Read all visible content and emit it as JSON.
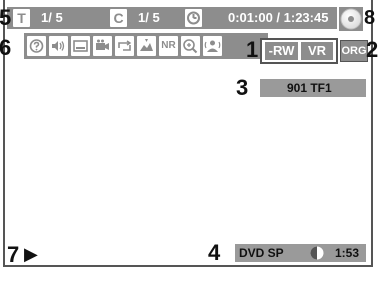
{
  "callouts": {
    "c1": "1",
    "c2": "2",
    "c3": "3",
    "c4": "4",
    "c5": "5",
    "c6": "6",
    "c7": "7",
    "c8": "8"
  },
  "status_bar": {
    "title_icon": "T",
    "title_counter": "1/  5",
    "chapter_icon": "C",
    "chapter_counter": "1/  5",
    "clock_icon": "clock-icon",
    "time": "0:01:00 / 1:23:45",
    "disc_icon": "disc-icon"
  },
  "function_icons": [
    {
      "name": "help-icon"
    },
    {
      "name": "audio-icon"
    },
    {
      "name": "subtitle-icon"
    },
    {
      "name": "camera-angle-icon"
    },
    {
      "name": "repeat-icon"
    },
    {
      "name": "marker-icon"
    },
    {
      "name": "noise-reduction-icon",
      "text": "NR"
    },
    {
      "name": "zoom-icon"
    },
    {
      "name": "virtual-surround-icon"
    }
  ],
  "format": {
    "disc_type": "-RW",
    "mode": "VR",
    "org": "ORG"
  },
  "channel": "901  TF1",
  "record": {
    "mode": "DVD SP",
    "time_left": "1:53"
  },
  "playback_arrow": "▶",
  "colors": {
    "bar_gray": "#8d8d8d",
    "panel_gray": "#9a9a9a",
    "frame": "#555555"
  }
}
